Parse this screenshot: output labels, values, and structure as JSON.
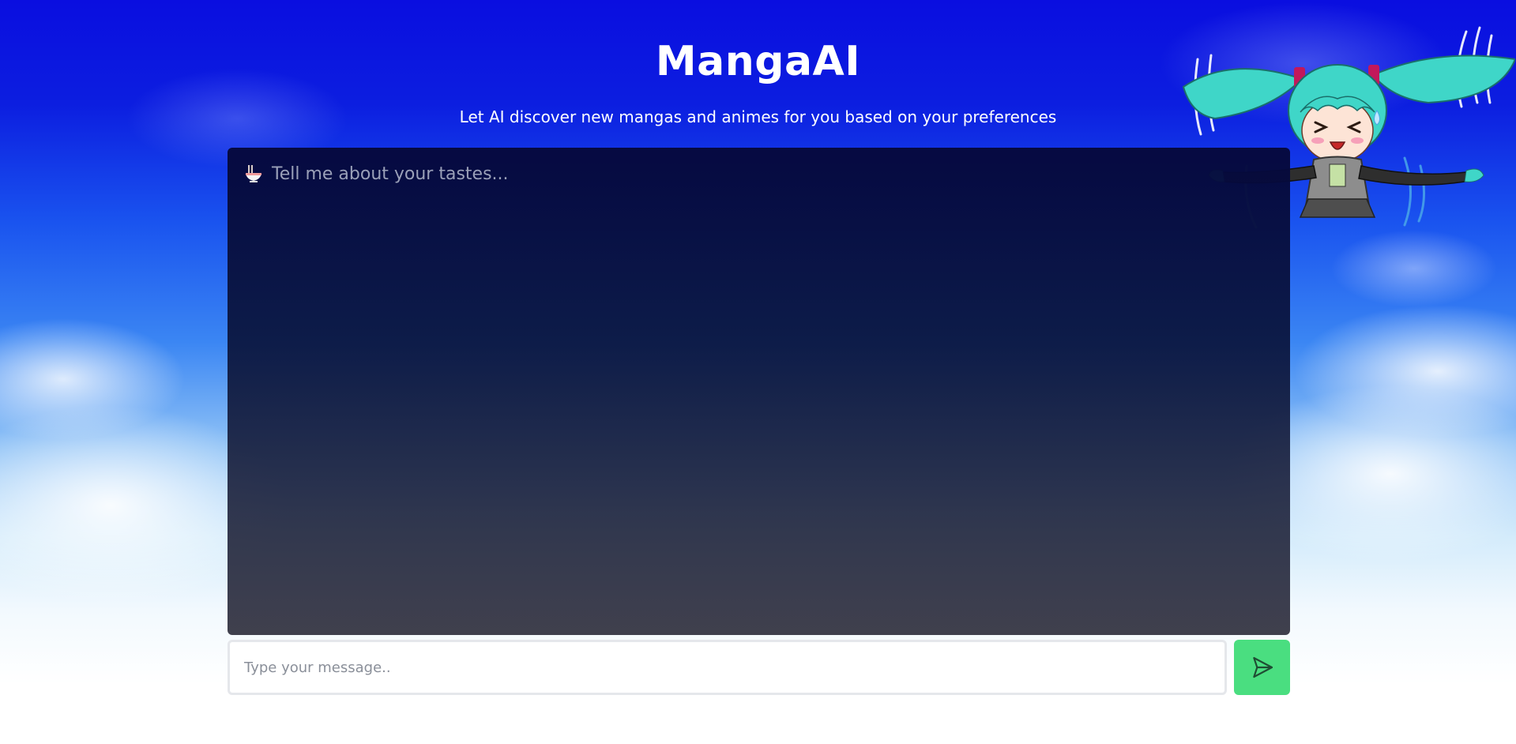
{
  "app": {
    "title": "MangaAI",
    "subtitle": "Let AI discover new mangas and animes for you based on your preferences"
  },
  "chat": {
    "intro_icon": "ramen-bowl-icon",
    "intro_text": "Tell me about your tastes..."
  },
  "composer": {
    "placeholder": "Type your message..",
    "value": "",
    "send_icon": "send-icon"
  },
  "mascot": {
    "icon": "chibi-mascot-illustration"
  },
  "colors": {
    "send_button": "#4ade80",
    "panel_top": "#05083c",
    "sky_top": "#0a0ee0"
  }
}
